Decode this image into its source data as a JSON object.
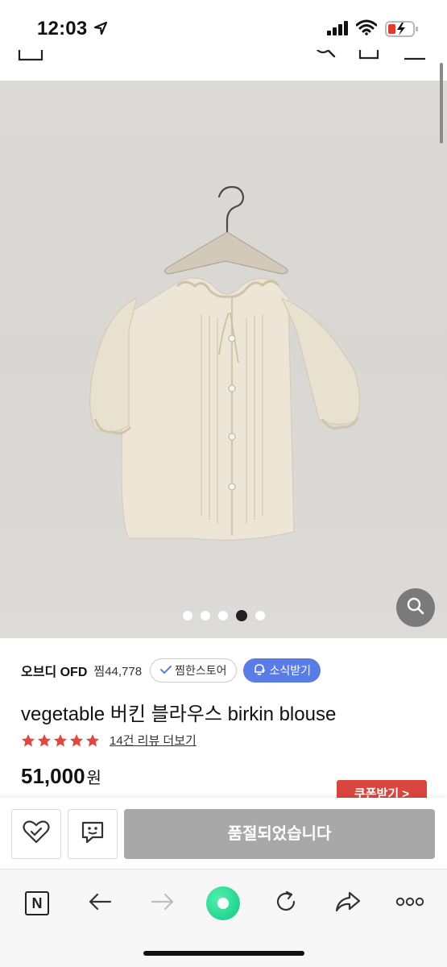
{
  "status_bar": {
    "time": "12:03"
  },
  "icons": {
    "location": "location-arrow-icon",
    "signal": "cellular-signal-icon",
    "wifi": "wifi-icon",
    "battery": "battery-charging-icon",
    "home": "home-icon",
    "search": "search-icon",
    "bag": "shopping-bag-icon",
    "menu": "hamburger-menu-icon",
    "zoom": "magnifier-icon"
  },
  "image_carousel": {
    "total_slides": 5,
    "active_slide": 4
  },
  "seller": {
    "name": "오브디 OFD",
    "jjim": "찜44,778",
    "jjim_store_label": "찜한스토어",
    "news_label": "소식받기"
  },
  "product": {
    "title": "vegetable 버킨 블라우스 birkin blouse",
    "rating_stars": 5,
    "review_link": "14건 리뷰 더보기",
    "price": "51,000",
    "price_unit": "원",
    "coupon_label": "쿠폰받기 >"
  },
  "buy_bar": {
    "soldout_label": "품절되었습니다"
  },
  "browser_toolbar": {
    "n_label": "N"
  },
  "colors": {
    "accent_blue": "#5a7ce6",
    "star_red": "#e0473f",
    "coupon_red": "#d9463e",
    "soldout_gray": "#a8a8a8",
    "green_button": "#12c98a"
  }
}
